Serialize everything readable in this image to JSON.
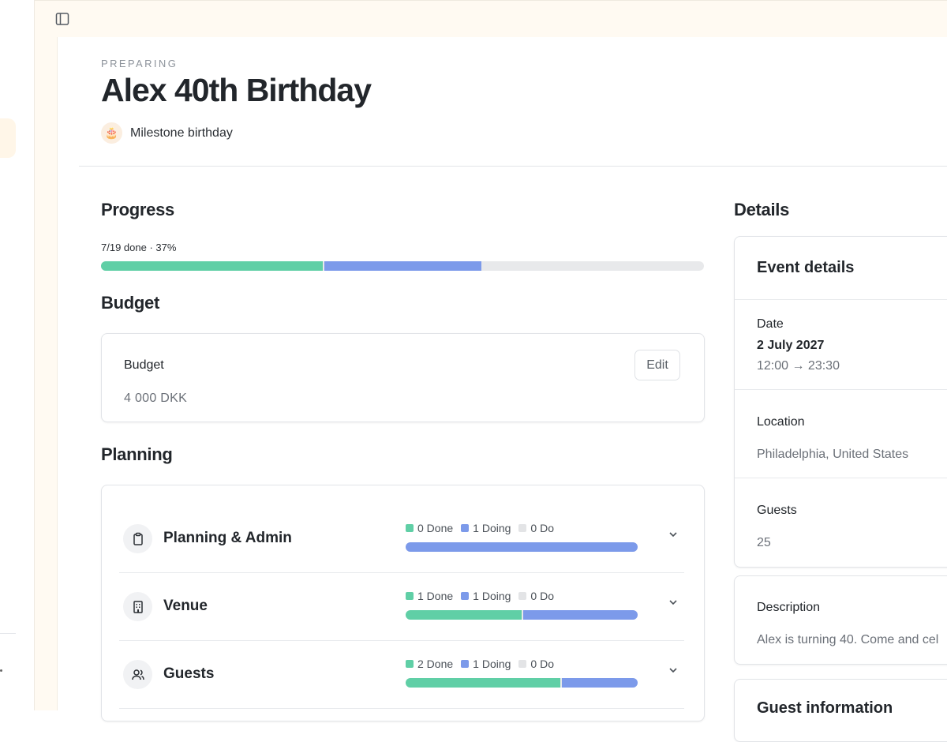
{
  "event": {
    "status": "PREPARING",
    "title": "Alex 40th Birthday",
    "type_label": "Milestone birthday",
    "type_icon": "birthday-cake-icon"
  },
  "progress": {
    "heading": "Progress",
    "summary": "7/19 done · 37%",
    "done_fraction": 0.368,
    "doing_fraction": 0.263
  },
  "budget": {
    "heading": "Budget",
    "card_label": "Budget",
    "amount": "4 000 DKK",
    "edit_label": "Edit"
  },
  "planning": {
    "heading": "Planning",
    "rows": [
      {
        "name": "Planning & Admin",
        "icon": "clipboard-icon",
        "done": "0 Done",
        "doing": "1 Doing",
        "todo": "0 Do",
        "done_count": 0,
        "doing_count": 1,
        "todo_count": 0
      },
      {
        "name": "Venue",
        "icon": "building-icon",
        "done": "1 Done",
        "doing": "1 Doing",
        "todo": "0 Do",
        "done_count": 1,
        "doing_count": 1,
        "todo_count": 0
      },
      {
        "name": "Guests",
        "icon": "users-icon",
        "done": "2 Done",
        "doing": "1 Doing",
        "todo": "0 Do",
        "done_count": 2,
        "doing_count": 1,
        "todo_count": 0
      }
    ]
  },
  "details": {
    "heading": "Details",
    "event_card_title": "Event details",
    "date_label": "Date",
    "date_value": "2 July 2027",
    "time_value": "12:00 → 23:30",
    "location_label": "Location",
    "location_value": "Philadelphia, United States",
    "guests_label": "Guests",
    "guests_value": "25",
    "description_label": "Description",
    "description_value": "Alex is turning 40. Come and cel",
    "guest_info_title": "Guest information"
  },
  "colors": {
    "done": "#60cfa6",
    "doing": "#7c9aea",
    "todo": "#e3e4e6",
    "accent_bg": "#fffaf2"
  }
}
